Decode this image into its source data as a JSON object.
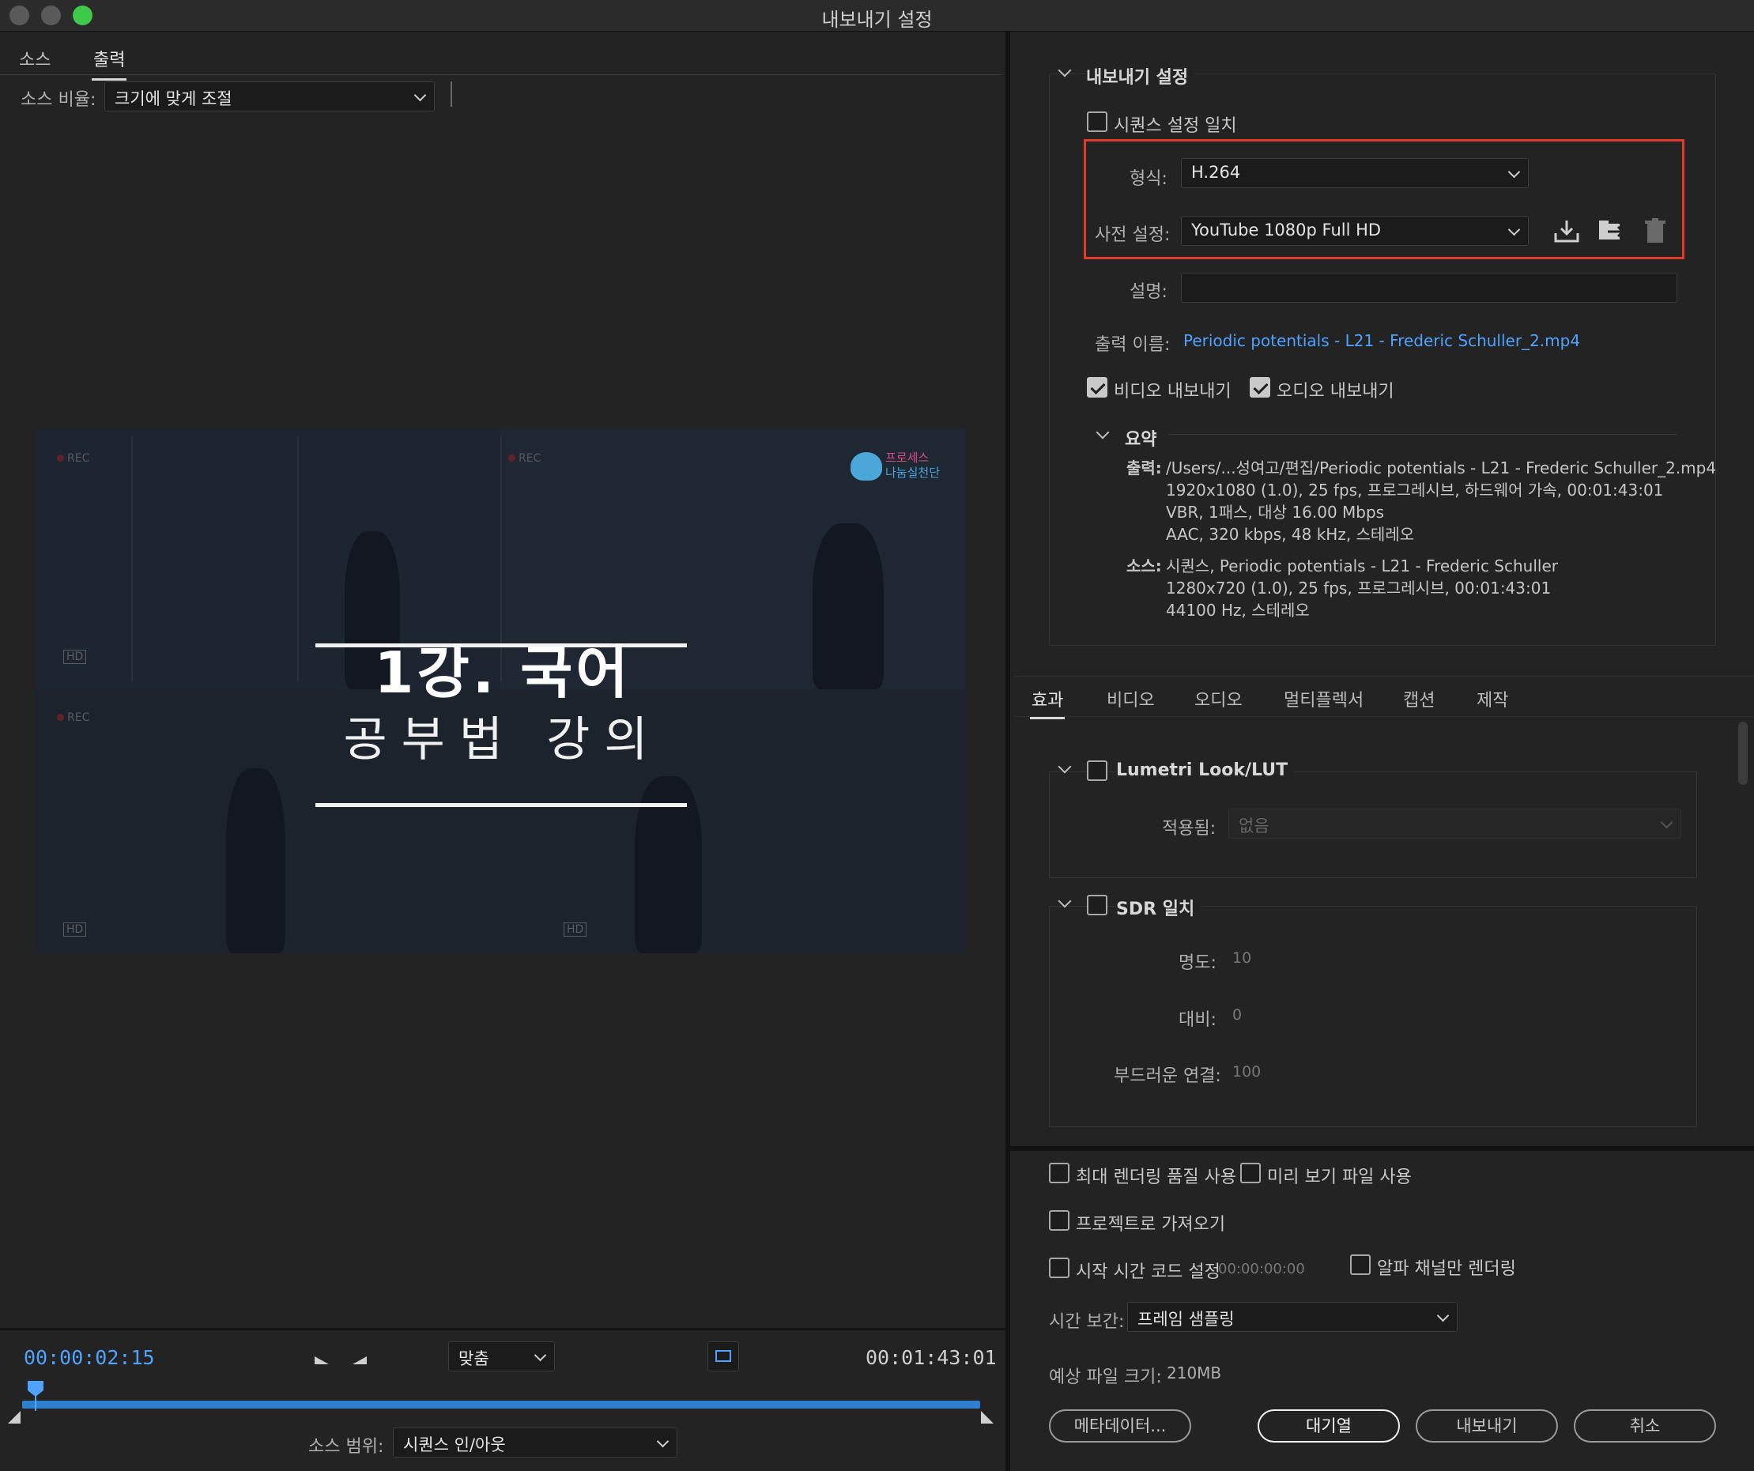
{
  "window": {
    "title": "내보내기 설정"
  },
  "left": {
    "tabs": [
      "소스",
      "출력"
    ],
    "source_ratio_label": "소스 비율:",
    "source_ratio_value": "크기에 맞게 조절",
    "preview": {
      "title": "1강. 국어",
      "subtitle": "공부법 강의",
      "logo_line1": "프로세스",
      "logo_line2": "나눔실천단",
      "rec_label": "REC",
      "hd_label": "HD"
    },
    "timecode_current": "00:00:02:15",
    "timecode_total": "00:01:43:01",
    "fit_label": "맞춤",
    "source_range_label": "소스 범위:",
    "source_range_value": "시퀀스 인/아웃",
    "playhead_fraction": 0.014
  },
  "right": {
    "export_settings": {
      "header": "내보내기 설정",
      "match_sequence": "시퀀스 설정 일치",
      "format_label": "형식:",
      "format_value": "H.264",
      "preset_label": "사전 설정:",
      "preset_value": "YouTube 1080p Full HD",
      "comment_label": "설명:",
      "comment_value": "",
      "output_name_label": "출력 이름:",
      "output_name_value": "Periodic potentials - L21 - Frederic Schuller_2.mp4",
      "export_video": "비디오 내보내기",
      "export_audio": "오디오 내보내기"
    },
    "summary": {
      "header": "요약",
      "output_label": "출력:",
      "output_lines": [
        "/Users/...성여고/편집/Periodic potentials - L21 - Frederic Schuller_2.mp4",
        "1920x1080 (1.0), 25 fps, 프로그레시브, 하드웨어 가속, 00:01:43:01",
        "VBR, 1패스, 대상 16.00 Mbps",
        "AAC, 320 kbps, 48 kHz, 스테레오"
      ],
      "source_label": "소스:",
      "source_lines": [
        "시퀀스, Periodic potentials - L21 - Frederic Schuller",
        "1280x720 (1.0), 25 fps, 프로그레시브, 00:01:43:01",
        "44100 Hz, 스테레오"
      ]
    },
    "tabs": [
      "효과",
      "비디오",
      "오디오",
      "멀티플렉서",
      "캡션",
      "제작"
    ],
    "effects": {
      "lumetri_header": "Lumetri Look/LUT",
      "applied_label": "적용됨:",
      "applied_value": "없음",
      "sdr_header": "SDR 일치",
      "brightness_label": "명도:",
      "brightness_value": "10",
      "contrast_label": "대비:",
      "contrast_value": "0",
      "soft_knee_label": "부드러운 연결:",
      "soft_knee_value": "100"
    },
    "options": {
      "max_render_quality": "최대 렌더링 품질 사용",
      "use_previews": "미리 보기 파일 사용",
      "import_into_project": "프로젝트로 가져오기",
      "set_start_timecode": "시작 시간 코드 설정",
      "start_timecode_value": "00:00:00:00",
      "render_alpha_only": "알파 채널만 렌더링",
      "time_interpolation_label": "시간 보간:",
      "time_interpolation_value": "프레임 샘플링",
      "estimated_size_label": "예상 파일 크기:",
      "estimated_size_value": "210MB"
    },
    "buttons": {
      "metadata": "메타데이터...",
      "queue": "대기열",
      "export": "내보내기",
      "cancel": "취소"
    }
  },
  "colors": {
    "accent": "#4fa3ff",
    "highlight_box": "#e23b2a",
    "background": "#232323"
  }
}
